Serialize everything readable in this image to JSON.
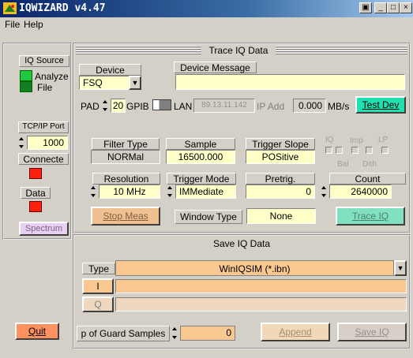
{
  "window": {
    "title": "IQWIZARD v4.47",
    "buttons": [
      "▣",
      "_",
      "□",
      "×"
    ]
  },
  "menu": {
    "file": "File",
    "help": "Help"
  },
  "left": {
    "iq_source_label": "IQ Source",
    "analyzer_label": "Analyze",
    "file_label": "File",
    "tcpip_label": "TCP/IP Port",
    "tcpip_value": "1000",
    "connected_label": "Connecte",
    "data_label": "Data",
    "spectrum_label": "Spectrum",
    "quit_label": "Quit"
  },
  "trace": {
    "title": "Trace IQ Data",
    "device_label": "Device",
    "device_value": "FSQ",
    "device_message_label": "Device Message",
    "device_message_value": "",
    "pad_label": "PAD",
    "pad_value": "20",
    "gpib_label": "GPIB",
    "lan_label": "LAN",
    "ip_value": "89.13.11.142",
    "ip_add_label": "IP Add",
    "rate_value": "0.000",
    "rate_unit": "MB/s",
    "test_dev_label": "Test Dev",
    "filter_type_label": "Filter Type",
    "filter_type_value": "NORMal",
    "sample_label": "Sample",
    "sample_value": "16500.000",
    "trigger_slope_label": "Trigger Slope",
    "trigger_slope_value": "POSitive",
    "iq_label": "IQ",
    "imp_label": "Imp",
    "lp_label": "LP",
    "bal_label": "Bal",
    "dith_label": "Dith",
    "resolution_label": "Resolution",
    "resolution_value": "10 MHz",
    "trigger_mode_label": "Trigger Mode",
    "trigger_mode_value": "IMMediate",
    "pretrig_label": "Pretrig.",
    "pretrig_value": "0",
    "count_label": "Count",
    "count_value": "2640000",
    "stop_meas_label": "Stop Meas",
    "window_type_label": "Window Type",
    "window_type_value": "None",
    "trace_iq_label": "Trace IQ"
  },
  "save": {
    "title": "Save IQ Data",
    "type_label": "Type",
    "type_value": "WinIQSIM (*.ibn)",
    "i_label": "I",
    "q_label": "Q",
    "i_path": "",
    "q_path": "",
    "guard_label": "p of Guard Samples",
    "guard_value": "0",
    "append_label": "Append",
    "save_iq_label": "Save IQ"
  },
  "colors": {
    "accent_yellow": "#ffffc8",
    "led_green": "#20c840",
    "led_red": "#ff2010",
    "orange": "#ff9060",
    "teal": "#20e0b0",
    "save_orange": "#f8c890"
  }
}
